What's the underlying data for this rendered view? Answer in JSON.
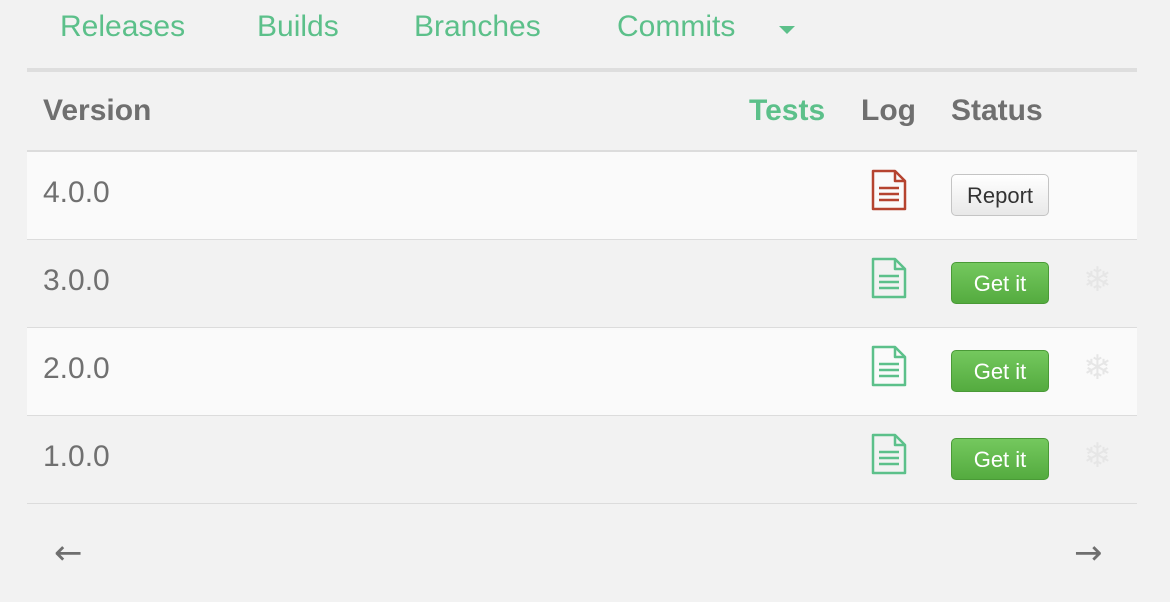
{
  "nav": {
    "items": [
      "Releases",
      "Builds",
      "Branches",
      "Commits"
    ],
    "dropdown_icon": "caret-down-icon"
  },
  "table": {
    "headers": {
      "version": "Version",
      "tests": "Tests",
      "log": "Log",
      "status": "Status"
    },
    "rows": [
      {
        "version": "4.0.0",
        "log_icon": "document-icon",
        "log_color": "#b5432f",
        "action": "Report",
        "freeze_icon": ""
      },
      {
        "version": "3.0.0",
        "log_icon": "document-icon",
        "log_color": "#5cc08a",
        "action": "Get it",
        "freeze_icon": "snowflake-icon"
      },
      {
        "version": "2.0.0",
        "log_icon": "document-icon",
        "log_color": "#5cc08a",
        "action": "Get it",
        "freeze_icon": "snowflake-icon"
      },
      {
        "version": "1.0.0",
        "log_icon": "document-icon",
        "log_color": "#5cc08a",
        "action": "Get it",
        "freeze_icon": "snowflake-icon"
      }
    ]
  },
  "pagination": {
    "prev": "←",
    "next": "→"
  },
  "colors": {
    "accent": "#5cc08a",
    "error": "#b5432f",
    "success_button": "#5cb346",
    "background": "#f2f2f2"
  }
}
